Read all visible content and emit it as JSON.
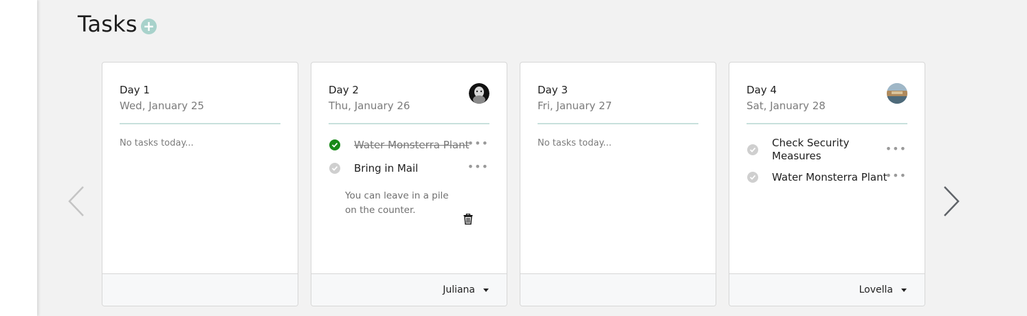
{
  "page": {
    "title": "Tasks",
    "add_icon": "plus-icon"
  },
  "nav": {
    "prev_icon": "chevron-left-icon",
    "next_icon": "chevron-right-icon"
  },
  "colors": {
    "accent": "#a8d2cb",
    "done": "#1a8a1a",
    "todo": "#cfcfcf",
    "divider": "#c8e0dc"
  },
  "days": [
    {
      "day": "Day 1",
      "date": "Wed, January 25",
      "empty": "No tasks today...",
      "assignee": ""
    },
    {
      "day": "Day 2",
      "date": "Thu, January 26",
      "assignee": "Juliana",
      "avatar": "avatar",
      "tasks": [
        {
          "title": "Water Monsterra Plant",
          "done": true
        },
        {
          "title": "Bring in Mail",
          "done": false,
          "note": "You can leave in a pile on the counter."
        }
      ]
    },
    {
      "day": "Day 3",
      "date": "Fri, January 27",
      "empty": "No tasks today...",
      "assignee": ""
    },
    {
      "day": "Day 4",
      "date": "Sat, January 28",
      "assignee": "Lovella",
      "avatar": "avatar",
      "tasks": [
        {
          "title": "Check Security Measures",
          "done": false
        },
        {
          "title": "Water Monsterra Plant",
          "done": false
        }
      ]
    }
  ]
}
